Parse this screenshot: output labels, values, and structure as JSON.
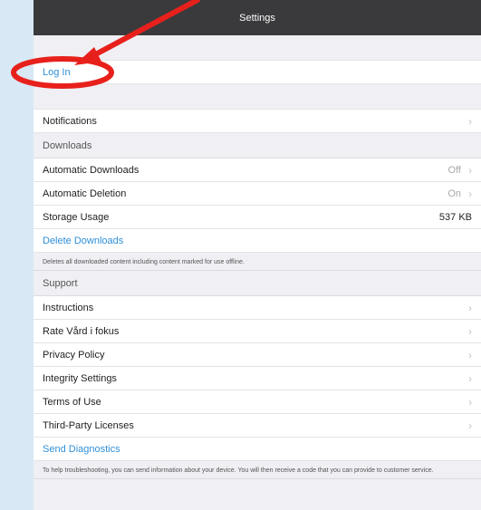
{
  "nav": {
    "title": "Settings"
  },
  "login": {
    "label": "Log In"
  },
  "notifications": {
    "label": "Notifications"
  },
  "downloads": {
    "header": "Downloads",
    "automatic_downloads": {
      "label": "Automatic Downloads",
      "value": "Off"
    },
    "automatic_deletion": {
      "label": "Automatic Deletion",
      "value": "On"
    },
    "storage_usage": {
      "label": "Storage Usage",
      "value": "537 KB"
    },
    "delete_label": "Delete Downloads",
    "note": "Deletes all downloaded content including content marked for use offline."
  },
  "support": {
    "header": "Support",
    "items": [
      {
        "label": "Instructions"
      },
      {
        "label": "Rate Vård i fokus"
      },
      {
        "label": "Privacy Policy"
      },
      {
        "label": "Integrity Settings"
      },
      {
        "label": "Terms of Use"
      },
      {
        "label": "Third-Party Licenses"
      }
    ],
    "send_diagnostics": "Send Diagnostics",
    "note": "To help troubleshooting, you can send information about your device. You will then receive a code that you can provide to customer service."
  },
  "icons": {
    "chevron": "chevron-right-icon"
  },
  "colors": {
    "link": "#2f8fd8",
    "navbar": "#3a3a3c",
    "annotation": "#e8201c"
  }
}
